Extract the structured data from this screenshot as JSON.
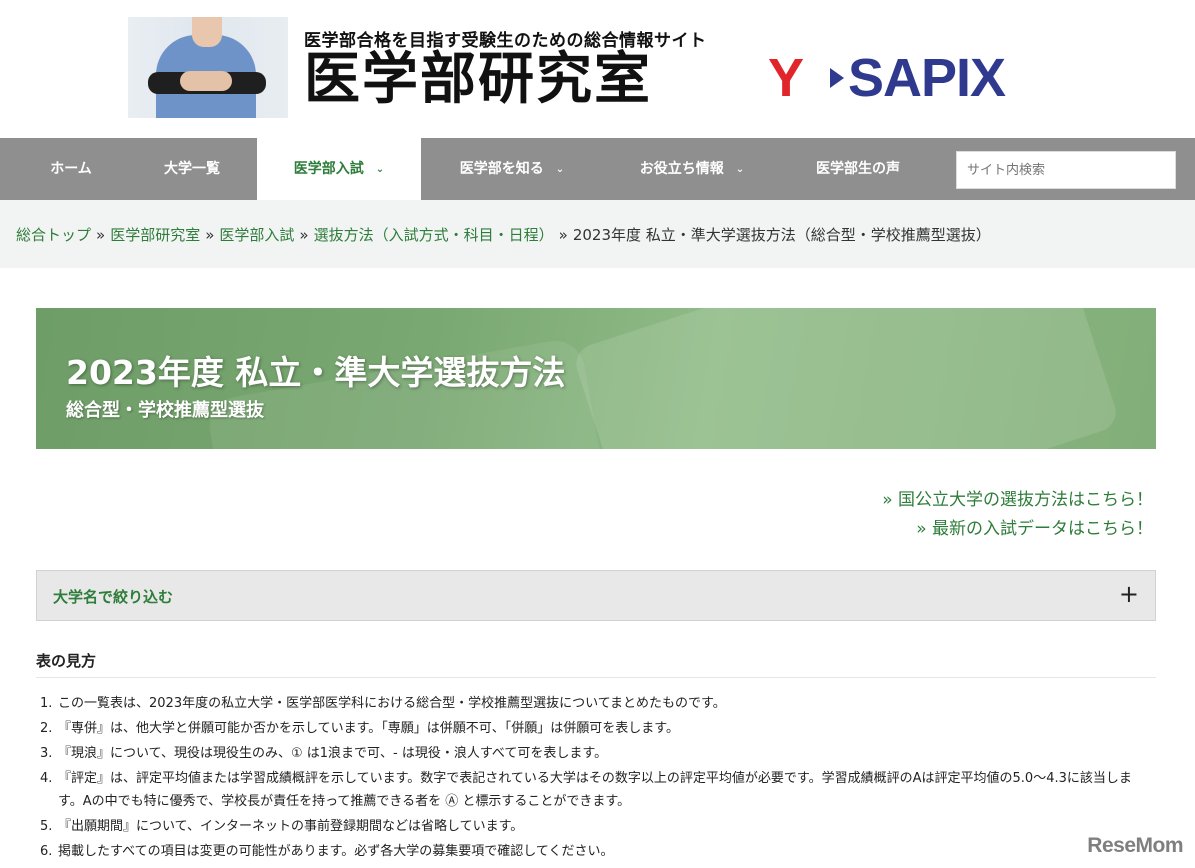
{
  "header": {
    "tagline": "医学部合格を目指す受験生のための総合情報サイト",
    "site_title": "医学部研究室",
    "brand_y": "Y",
    "brand_rest": "SAPIX"
  },
  "nav": {
    "items": [
      {
        "label": "ホーム"
      },
      {
        "label": "大学一覧"
      },
      {
        "label": "医学部入試",
        "dropdown": true,
        "active": true
      },
      {
        "label": "医学部を知る",
        "dropdown": true
      },
      {
        "label": "お役立ち情報",
        "dropdown": true
      },
      {
        "label": "医学部生の声"
      }
    ],
    "search_placeholder": "サイト内検索"
  },
  "breadcrumb": {
    "links": [
      "総合トップ",
      "医学部研究室",
      "医学部入試",
      "選抜方法（入試方式・科目・日程）"
    ],
    "current": "2023年度 私立・準大学選抜方法（総合型・学校推薦型選抜）",
    "separator": "»"
  },
  "banner": {
    "title": "2023年度 私立・準大学選抜方法",
    "subtitle": "総合型・学校推薦型選抜"
  },
  "side_links": [
    "» 国公立大学の選抜方法はこちら！",
    "» 最新の入試データはこちら！"
  ],
  "filter": {
    "label": "大学名で絞り込む",
    "toggle": "+"
  },
  "legend": {
    "title": "表の見方",
    "items": [
      "この一覧表は、2023年度の私立大学・医学部医学科における総合型・学校推薦型選抜についてまとめたものです。",
      "『専併』は、他大学と併願可能か否かを示しています。「専願」は併願不可、「併願」は併願可を表します。",
      "『現浪』について、現役は現役生のみ、① は1浪まで可、- は現役・浪人すべて可を表します。",
      "『評定』は、評定平均値または学習成績概評を示しています。数字で表記されている大学はその数字以上の評定平均値が必要です。学習成績概評のAは評定平均値の5.0〜4.3に該当します。Aの中でも特に優秀で、学校長が責任を持って推薦できる者を Ⓐ と標示することができます。",
      "『出願期間』について、インターネットの事前登録期間などは省略しています。",
      "掲載したすべての項目は変更の可能性があります。必ず各大学の募集要項で確認してください。"
    ]
  },
  "watermark": "ReseMom",
  "colors": {
    "accent_green": "#2e7d3a",
    "nav_gray": "#8f8f8f",
    "banner_green": "#7aa872",
    "brand_red": "#e0262b",
    "brand_navy": "#2f3a8f"
  }
}
